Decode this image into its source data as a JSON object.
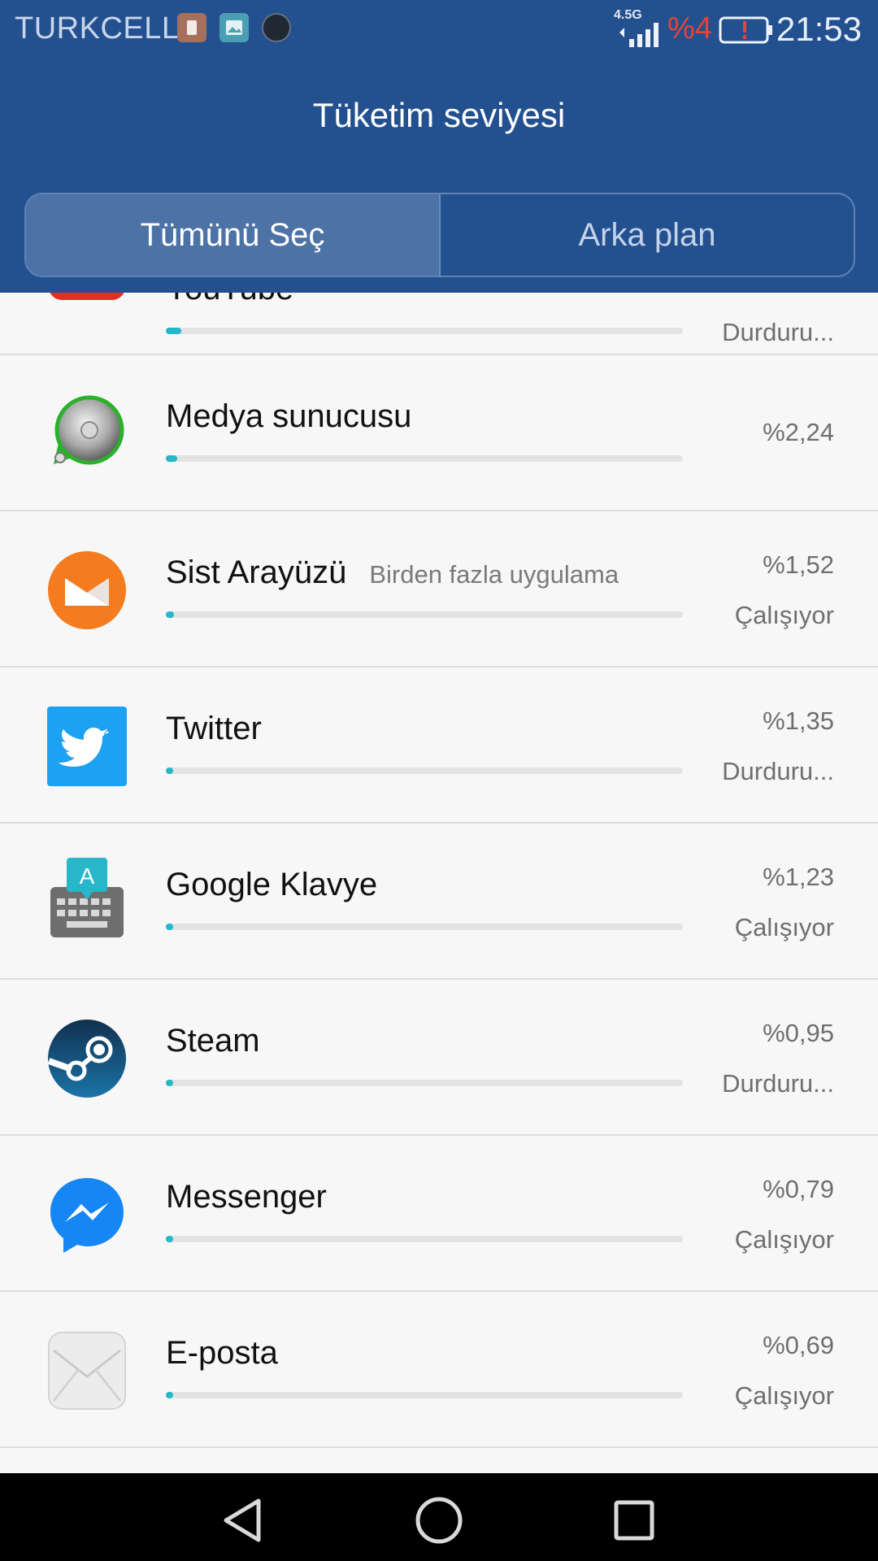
{
  "status_bar": {
    "carrier": "TURKCELL",
    "network": "4.5G",
    "battery_percent": "%4",
    "time": "21:53"
  },
  "header": {
    "title": "Tüketim seviyesi",
    "tabs": [
      {
        "label": "Tümünü Seç",
        "active": true
      },
      {
        "label": "Arka plan",
        "active": false
      }
    ]
  },
  "apps": [
    {
      "name": "YouTube",
      "subtitle": "",
      "percent": "",
      "state": "Durduru...",
      "usage": 0.03,
      "icon": "youtube-icon"
    },
    {
      "name": "Medya sunucusu",
      "subtitle": "",
      "percent": "%2,24",
      "state": "",
      "usage": 0.0224,
      "icon": "media-server-icon"
    },
    {
      "name": "Sist Arayüzü",
      "subtitle": "Birden fazla uygulama",
      "percent": "%1,52",
      "state": "Çalışıyor",
      "usage": 0.0152,
      "icon": "system-ui-icon"
    },
    {
      "name": "Twitter",
      "subtitle": "",
      "percent": "%1,35",
      "state": "Durduru...",
      "usage": 0.0135,
      "icon": "twitter-icon"
    },
    {
      "name": "Google Klavye",
      "subtitle": "",
      "percent": "%1,23",
      "state": "Çalışıyor",
      "usage": 0.0123,
      "icon": "keyboard-icon"
    },
    {
      "name": "Steam",
      "subtitle": "",
      "percent": "%0,95",
      "state": "Durduru...",
      "usage": 0.0095,
      "icon": "steam-icon"
    },
    {
      "name": "Messenger",
      "subtitle": "",
      "percent": "%0,79",
      "state": "Çalışıyor",
      "usage": 0.0079,
      "icon": "messenger-icon"
    },
    {
      "name": "E-posta",
      "subtitle": "",
      "percent": "%0,69",
      "state": "Çalışıyor",
      "usage": 0.0069,
      "icon": "email-icon"
    }
  ],
  "colors": {
    "header_bg": "#23508f",
    "bar_fill": "#26b7c9",
    "battery_warning": "#e2453a"
  }
}
